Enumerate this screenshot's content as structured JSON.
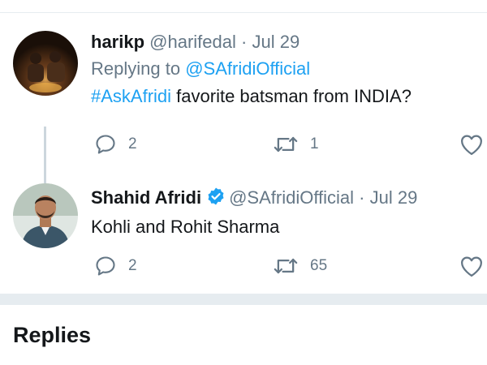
{
  "tweets": [
    {
      "name": "harikp",
      "handle": "@harifedal",
      "separator": "·",
      "date": "Jul 29",
      "replying_prefix": "Replying to",
      "replying_to": "@SAfridiOfficial",
      "hashtag": "#AskAfridi",
      "text": " favorite batsman from INDIA?",
      "reply_count": "2",
      "retweet_count": "1",
      "like_count": ""
    },
    {
      "name": "Shahid Afridi",
      "verified": true,
      "handle": "@SAfridiOfficial",
      "separator": "·",
      "date": "Jul 29",
      "text": "Kohli and Rohit Sharma",
      "reply_count": "2",
      "retweet_count": "65",
      "like_count": ""
    }
  ],
  "section": {
    "replies_heading": "Replies"
  },
  "icons": {
    "reply": "reply-icon",
    "retweet": "retweet-icon",
    "like": "heart-icon",
    "verified": "verified-badge-icon"
  },
  "colors": {
    "accent": "#1da1f2",
    "secondary_text": "#657786",
    "primary_text": "#14171a",
    "separator": "#e6ecf0",
    "thread_line": "#ccd6dd"
  }
}
